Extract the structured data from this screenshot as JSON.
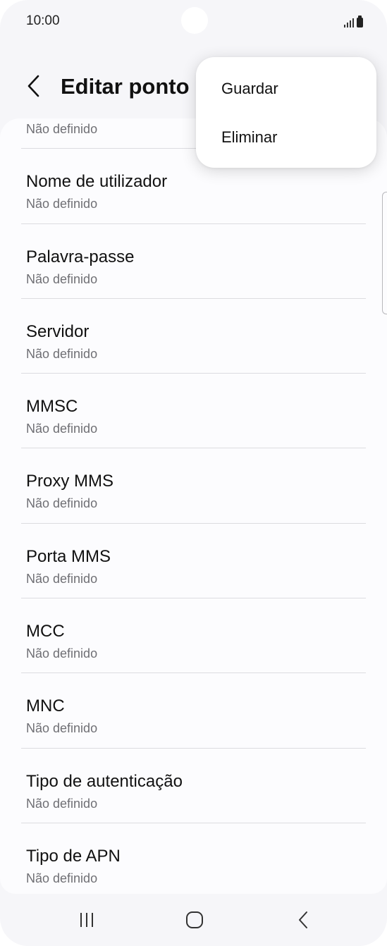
{
  "status_bar": {
    "time": "10:00",
    "icons": [
      "signal-icon",
      "battery-icon"
    ]
  },
  "header": {
    "title": "Editar ponto d"
  },
  "settings": [
    {
      "label": "",
      "value": "Não definido"
    },
    {
      "label": "Nome de utilizador",
      "value": "Não definido"
    },
    {
      "label": "Palavra-passe",
      "value": "Não definido"
    },
    {
      "label": "Servidor",
      "value": "Não definido"
    },
    {
      "label": "MMSC",
      "value": "Não definido"
    },
    {
      "label": "Proxy MMS",
      "value": "Não definido"
    },
    {
      "label": "Porta MMS",
      "value": "Não definido"
    },
    {
      "label": "MCC",
      "value": "Não definido"
    },
    {
      "label": "MNC",
      "value": "Não definido"
    },
    {
      "label": "Tipo de autenticação",
      "value": "Não definido"
    },
    {
      "label": "Tipo de APN",
      "value": "Não definido"
    }
  ],
  "menu": {
    "save_label": "Guardar",
    "delete_label": "Eliminar"
  },
  "nav_bar": {
    "icons": [
      "recent-apps-icon",
      "home-icon",
      "back-icon"
    ]
  },
  "colors": {
    "background": "#f6f6f9",
    "card": "#fcfcfe",
    "secondary_text": "#6f6f74",
    "divider": "#dcdce0"
  }
}
